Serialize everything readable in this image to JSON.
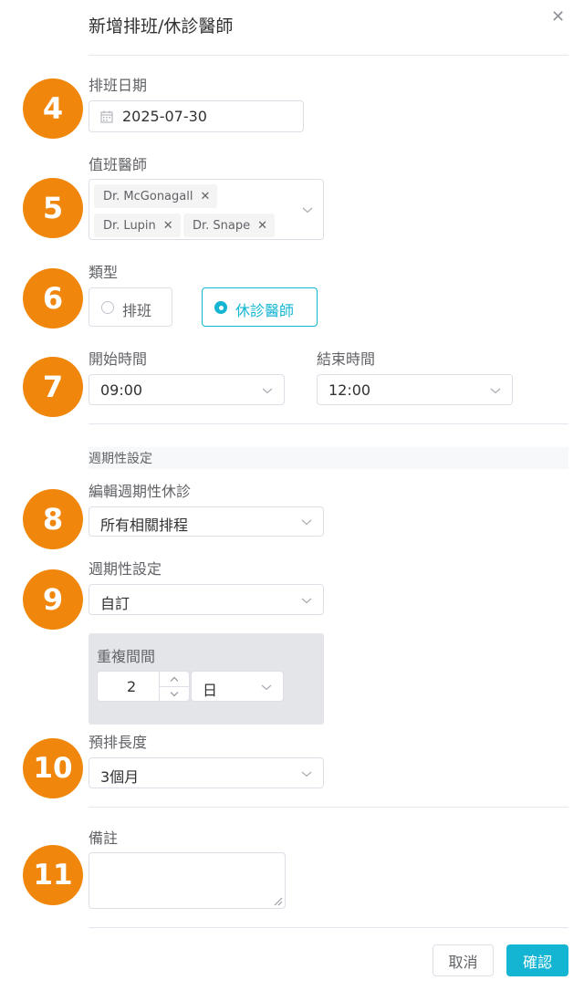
{
  "dialog": {
    "title": "新增排班/休診醫師"
  },
  "badges": [
    "4",
    "5",
    "6",
    "7",
    "8",
    "9",
    "10",
    "11"
  ],
  "schedule_date": {
    "label": "排班日期",
    "value": "2025-07-30"
  },
  "doctors": {
    "label": "值班醫師",
    "tags": [
      "Dr. McGonagall",
      "Dr. Lupin",
      "Dr. Snape"
    ]
  },
  "type": {
    "label": "類型",
    "options": [
      {
        "label": "排班",
        "selected": false
      },
      {
        "label": "休診醫師",
        "selected": true
      }
    ]
  },
  "start_time": {
    "label": "開始時間",
    "value": "09:00"
  },
  "end_time": {
    "label": "結束時間",
    "value": "12:00"
  },
  "recurrence": {
    "section_label": "週期性設定",
    "edit_label": "編輯週期性休診",
    "edit_value": "所有相關排程",
    "setting_label": "週期性設定",
    "setting_value": "自訂",
    "interval_label": "重複間間",
    "interval_value": "2",
    "interval_unit": "日",
    "length_label": "預排長度",
    "length_value": "3個月"
  },
  "notes": {
    "label": "備註",
    "value": ""
  },
  "buttons": {
    "cancel": "取消",
    "confirm": "確認"
  },
  "colors": {
    "accent": "#13b5d2",
    "badge": "#f0870c"
  }
}
